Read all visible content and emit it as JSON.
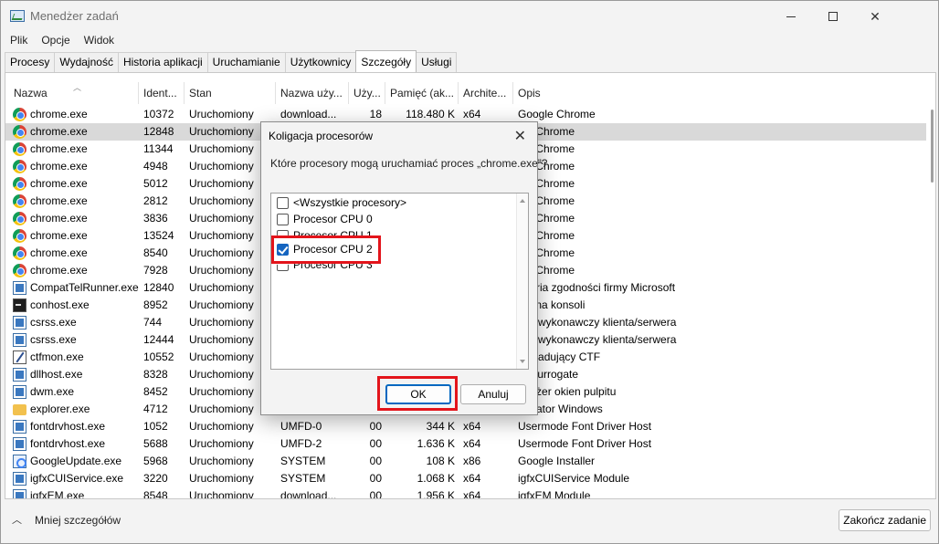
{
  "window": {
    "title": "Menedżer zadań"
  },
  "menu": [
    "Plik",
    "Opcje",
    "Widok"
  ],
  "tabs": [
    "Procesy",
    "Wydajność",
    "Historia aplikacji",
    "Uruchamianie",
    "Użytkownicy",
    "Szczegóły",
    "Usługi"
  ],
  "columns": {
    "name": "Nazwa",
    "pid": "Ident...",
    "status": "Stan",
    "user": "Nazwa uży...",
    "cpu": "Uży...",
    "memory": "Pamięć (ak...",
    "arch": "Archite...",
    "desc": "Opis"
  },
  "rows": [
    {
      "name": "chrome.exe",
      "pid": "10372",
      "status": "Uruchomiony",
      "user": "download...",
      "cpu": "18",
      "memory": "118.480 K",
      "arch": "x64",
      "desc": "Google Chrome",
      "icon": "chrome-icon"
    },
    {
      "name": "chrome.exe",
      "pid": "12848",
      "status": "Uruchomiony",
      "user": "",
      "cpu": "",
      "memory": "",
      "arch": "",
      "desc": "gle Chrome",
      "icon": "chrome-icon",
      "selected": true
    },
    {
      "name": "chrome.exe",
      "pid": "11344",
      "status": "Uruchomiony",
      "user": "",
      "cpu": "",
      "memory": "",
      "arch": "",
      "desc": "gle Chrome",
      "icon": "chrome-icon"
    },
    {
      "name": "chrome.exe",
      "pid": "4948",
      "status": "Uruchomiony",
      "user": "",
      "cpu": "",
      "memory": "",
      "arch": "",
      "desc": "gle Chrome",
      "icon": "chrome-icon"
    },
    {
      "name": "chrome.exe",
      "pid": "5012",
      "status": "Uruchomiony",
      "user": "",
      "cpu": "",
      "memory": "",
      "arch": "",
      "desc": "gle Chrome",
      "icon": "chrome-icon"
    },
    {
      "name": "chrome.exe",
      "pid": "2812",
      "status": "Uruchomiony",
      "user": "",
      "cpu": "",
      "memory": "",
      "arch": "",
      "desc": "gle Chrome",
      "icon": "chrome-icon"
    },
    {
      "name": "chrome.exe",
      "pid": "3836",
      "status": "Uruchomiony",
      "user": "",
      "cpu": "",
      "memory": "",
      "arch": "",
      "desc": "gle Chrome",
      "icon": "chrome-icon"
    },
    {
      "name": "chrome.exe",
      "pid": "13524",
      "status": "Uruchomiony",
      "user": "",
      "cpu": "",
      "memory": "",
      "arch": "",
      "desc": "gle Chrome",
      "icon": "chrome-icon"
    },
    {
      "name": "chrome.exe",
      "pid": "8540",
      "status": "Uruchomiony",
      "user": "",
      "cpu": "",
      "memory": "",
      "arch": "",
      "desc": "gle Chrome",
      "icon": "chrome-icon"
    },
    {
      "name": "chrome.exe",
      "pid": "7928",
      "status": "Uruchomiony",
      "user": "",
      "cpu": "",
      "memory": "",
      "arch": "",
      "desc": "gle Chrome",
      "icon": "chrome-icon"
    },
    {
      "name": "CompatTelRunner.exe",
      "pid": "12840",
      "status": "Uruchomiony",
      "user": "",
      "cpu": "",
      "memory": "",
      "arch": "",
      "desc": "metria zgodności firmy Microsoft",
      "icon": "window-icon"
    },
    {
      "name": "conhost.exe",
      "pid": "8952",
      "status": "Uruchomiony",
      "user": "",
      "cpu": "",
      "memory": "",
      "arch": "",
      "desc": "t okna konsoli",
      "icon": "console-icon"
    },
    {
      "name": "csrss.exe",
      "pid": "744",
      "status": "Uruchomiony",
      "user": "",
      "cpu": "",
      "memory": "",
      "arch": "",
      "desc": "ces wykonawczy klienta/serwera",
      "icon": "window-icon"
    },
    {
      "name": "csrss.exe",
      "pid": "12444",
      "status": "Uruchomiony",
      "user": "",
      "cpu": "",
      "memory": "",
      "arch": "",
      "desc": "ces wykonawczy klienta/serwera",
      "icon": "window-icon"
    },
    {
      "name": "ctfmon.exe",
      "pid": "10552",
      "status": "Uruchomiony",
      "user": "",
      "cpu": "",
      "memory": "",
      "arch": "",
      "desc": "duł ładujący CTF",
      "icon": "pen-icon"
    },
    {
      "name": "dllhost.exe",
      "pid": "8328",
      "status": "Uruchomiony",
      "user": "",
      "cpu": "",
      "memory": "",
      "arch": "",
      "desc": "M Surrogate",
      "icon": "window-icon"
    },
    {
      "name": "dwm.exe",
      "pid": "8452",
      "status": "Uruchomiony",
      "user": "",
      "cpu": "",
      "memory": "",
      "arch": "",
      "desc": "nedżer okien pulpitu",
      "icon": "window-icon"
    },
    {
      "name": "explorer.exe",
      "pid": "4712",
      "status": "Uruchomiony",
      "user": "",
      "cpu": "",
      "memory": "",
      "arch": "",
      "desc": "plorator Windows",
      "icon": "folder-icon"
    },
    {
      "name": "fontdrvhost.exe",
      "pid": "1052",
      "status": "Uruchomiony",
      "user": "UMFD-0",
      "cpu": "00",
      "memory": "344 K",
      "arch": "x64",
      "desc": "Usermode Font Driver Host",
      "icon": "window-icon"
    },
    {
      "name": "fontdrvhost.exe",
      "pid": "5688",
      "status": "Uruchomiony",
      "user": "UMFD-2",
      "cpu": "00",
      "memory": "1.636 K",
      "arch": "x64",
      "desc": "Usermode Font Driver Host",
      "icon": "window-icon"
    },
    {
      "name": "GoogleUpdate.exe",
      "pid": "5968",
      "status": "Uruchomiony",
      "user": "SYSTEM",
      "cpu": "00",
      "memory": "108 K",
      "arch": "x86",
      "desc": "Google Installer",
      "icon": "google-update-icon"
    },
    {
      "name": "igfxCUIService.exe",
      "pid": "3220",
      "status": "Uruchomiony",
      "user": "SYSTEM",
      "cpu": "00",
      "memory": "1.068 K",
      "arch": "x64",
      "desc": "igfxCUIService Module",
      "icon": "window-icon"
    },
    {
      "name": "igfxEM.exe",
      "pid": "8548",
      "status": "Uruchomiony",
      "user": "download...",
      "cpu": "00",
      "memory": "1.956 K",
      "arch": "x64",
      "desc": "igfxEM Module",
      "icon": "window-icon"
    }
  ],
  "footer": {
    "fewer_details": "Mniej szczegółów",
    "end_task": "Zakończ zadanie"
  },
  "dialog": {
    "title": "Koligacja procesorów",
    "question": "Które procesory mogą uruchamiać proces „chrome.exe”?",
    "options": [
      {
        "label": "<Wszystkie procesory>",
        "checked": false
      },
      {
        "label": "Procesor CPU 0",
        "checked": false
      },
      {
        "label": "Procesor CPU 1",
        "checked": false
      },
      {
        "label": "Procesor CPU 2",
        "checked": true
      },
      {
        "label": "Procesor CPU 3",
        "checked": false
      }
    ],
    "ok_label": "OK",
    "cancel_label": "Anuluj"
  },
  "colors": {
    "highlight": "#e3141b",
    "selection": "#d9d9d9",
    "accent": "#0067c0"
  }
}
